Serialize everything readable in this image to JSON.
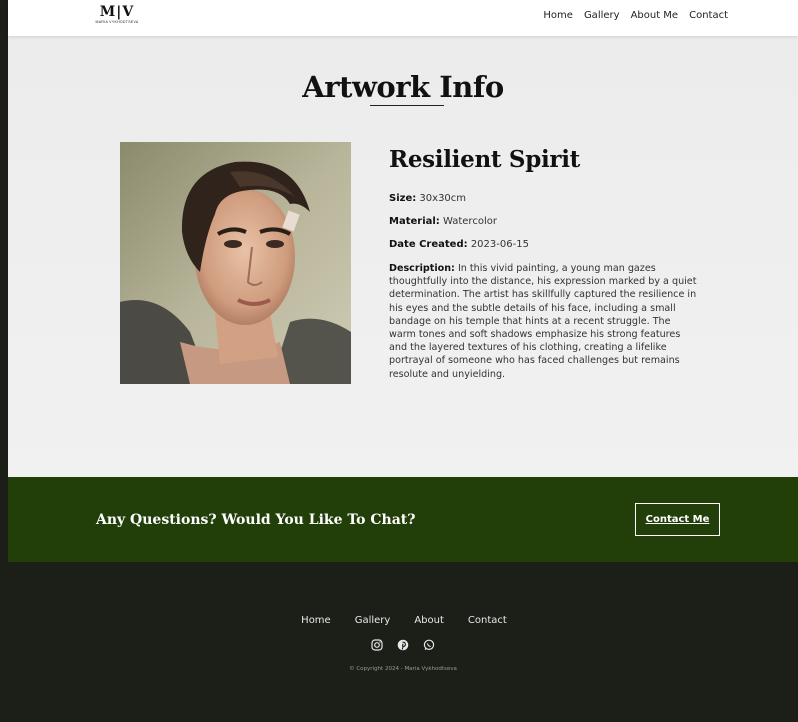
{
  "header": {
    "logo_mark": "M|V",
    "logo_sub": "MARIA VYKHODTSEVA",
    "nav": [
      "Home",
      "Gallery",
      "About Me",
      "Contact"
    ]
  },
  "main": {
    "title": "Artwork Info",
    "artwork": {
      "title": "Resilient Spirit",
      "size_label": "Size:",
      "size": "30x30cm",
      "material_label": "Material:",
      "material": "Watercolor",
      "date_label": "Date Created:",
      "date": "2023-06-15",
      "description_label": "Description:",
      "description": "In this vivid painting, a young man gazes thoughtfully into the distance, his expression marked by a quiet determination. The artist has skillfully captured the resilience in his eyes and the subtle details of his face, including a small bandage on his temple that hints at a recent struggle. The warm tones and soft shadows emphasize his strong features and the layered textures of his clothing, creating a lifelike portrayal of someone who has faced challenges but remains resolute and unyielding."
    }
  },
  "cta": {
    "text": "Any Questions? Would You Like To Chat?",
    "button": "Contact Me"
  },
  "footer": {
    "nav": [
      "Home",
      "Gallery",
      "About",
      "Contact"
    ],
    "socials": [
      "instagram-icon",
      "pinterest-icon",
      "whatsapp-icon"
    ],
    "copyright": "© Copyright 2024 - Maria Vykhodtseva"
  },
  "colors": {
    "cta_bg": "#223f09",
    "footer_bg": "#1c1f17"
  }
}
